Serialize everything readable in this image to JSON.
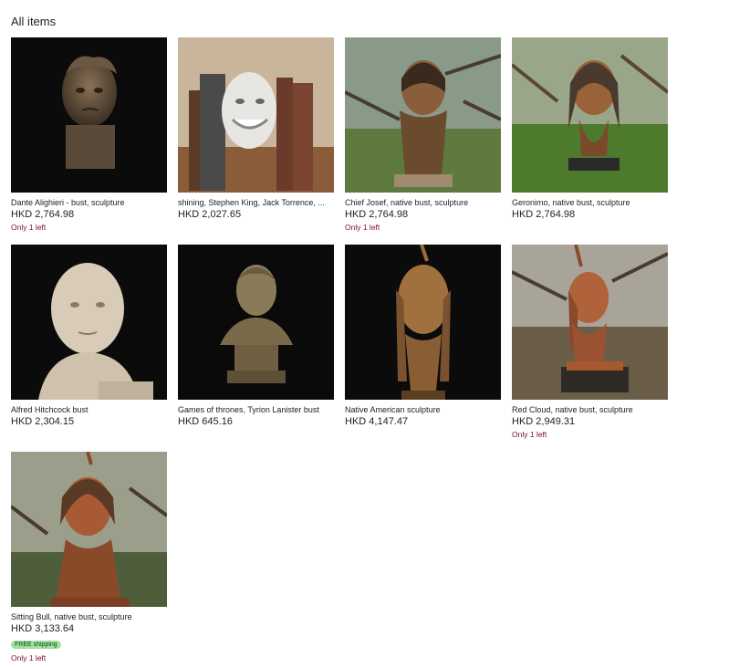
{
  "page": {
    "heading": "All items"
  },
  "items": [
    {
      "title": "Dante Alighieri - bust, sculpture",
      "price": "HKD 2,764.98",
      "stock": "Only 1 left",
      "image": "dante-bust-photo"
    },
    {
      "title": "shining, Stephen King, Jack Torrence, ...",
      "price": "HKD 2,027.65",
      "stock": "",
      "image": "jack-torrance-bookend-photo"
    },
    {
      "title": "Chief Josef, native bust, sculpture",
      "price": "HKD 2,764.98",
      "stock": "Only 1 left",
      "image": "chief-joseph-bust-photo"
    },
    {
      "title": "Geronimo, native bust, sculpture",
      "price": "HKD 2,764.98",
      "stock": "",
      "image": "geronimo-bust-photo"
    },
    {
      "title": "Alfred Hitchcock bust",
      "price": "HKD 2,304.15",
      "stock": "",
      "image": "hitchcock-bust-photo"
    },
    {
      "title": "Games of thrones, Tyrion Lanister bust",
      "price": "HKD 645.16",
      "stock": "",
      "image": "tyrion-bust-photo"
    },
    {
      "title": "Native American sculpture",
      "price": "HKD 4,147.47",
      "stock": "",
      "image": "native-american-bust-photo"
    },
    {
      "title": "Red Cloud, native bust, sculpture",
      "price": "HKD 2,949.31",
      "stock": "Only 1 left",
      "image": "red-cloud-bust-photo"
    },
    {
      "title": "Sitting Bull, native bust, sculpture",
      "price": "HKD 3,133.64",
      "badge": "FREE shipping",
      "stock": "Only 1 left",
      "image": "sitting-bull-bust-photo"
    }
  ],
  "colors": {
    "stock_text": "#7a1022",
    "badge_bg": "#9ee39e"
  }
}
